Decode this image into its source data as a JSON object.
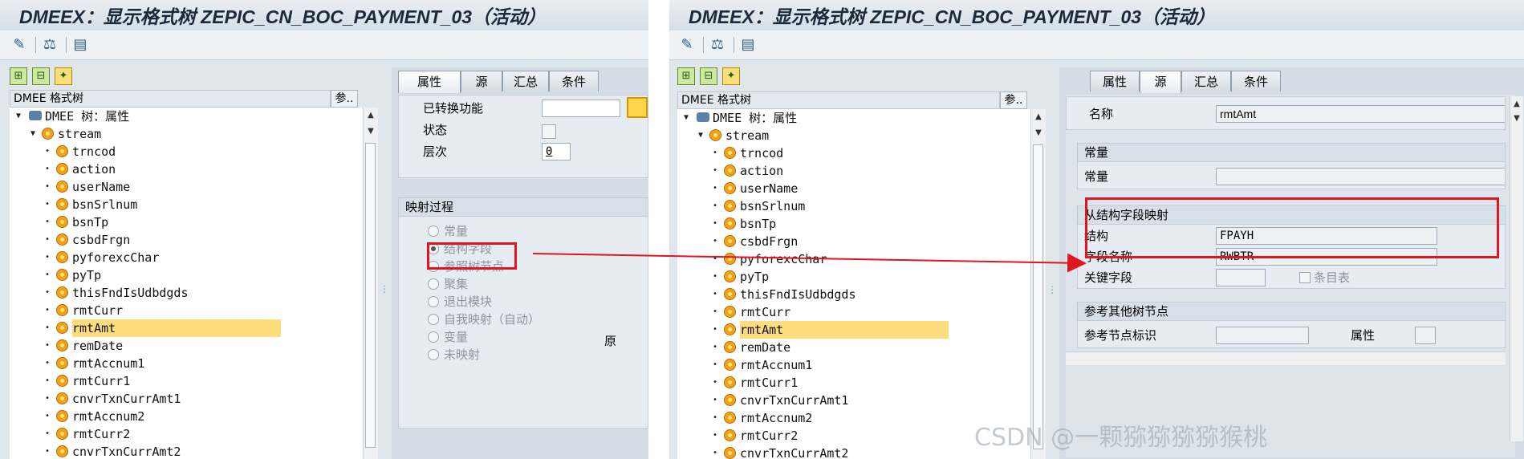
{
  "window_title": "DMEEX：显示格式树 ZEPIC_CN_BOC_PAYMENT_03（活动）",
  "toolbar_icons": [
    "display-change-icon",
    "other-object-icon",
    "hierarchy-icon"
  ],
  "tree": {
    "header_label": "DMEE 格式树",
    "header_button": "参..",
    "root_label": "DMEE 树：属性",
    "stream_label": "stream",
    "nodes": [
      "trncod",
      "action",
      "userName",
      "bsnSrlnum",
      "bsnTp",
      "csbdFrgn",
      "pyforexcChar",
      "pyTp",
      "thisFndIsUdbdgds",
      "rmtCurr",
      "rmtAmt",
      "remDate",
      "rmtAccnum1",
      "rmtCurr1",
      "cnvrTxnCurrAmt1",
      "rmtAccnum2",
      "rmtCurr2",
      "cnvrTxnCurrAmt2"
    ],
    "selected": "rmtAmt"
  },
  "left_panel": {
    "tabs": [
      "属性",
      "源",
      "汇总",
      "条件"
    ],
    "active_tab": "属性",
    "fields": {
      "conversion_label": "已转换功能",
      "status_label": "状态",
      "level_label": "层次",
      "level_value": "0"
    },
    "mapping": {
      "title": "映射过程",
      "options": [
        "常量",
        "结构字段",
        "参照树节点",
        "聚集",
        "退出模块",
        "自我映射（自动）",
        "变量",
        "未映射"
      ],
      "selected": "结构字段",
      "trailing_text": "原"
    }
  },
  "right_panel": {
    "tabs": [
      "属性",
      "源",
      "汇总",
      "条件"
    ],
    "active_tab": "源",
    "name_label": "名称",
    "name_value": "rmtAmt",
    "constant_group": "常量",
    "constant_label": "常量",
    "constant_value": "",
    "struct_group": "从结构字段映射",
    "struct_label": "结构",
    "struct_value": "FPAYH",
    "field_label": "字段名称",
    "field_value": "RWBTR",
    "key_label": "关键字段",
    "entry_table_label": "条目表",
    "ref_group": "参考其他树节点",
    "ref_label": "参考节点标识",
    "attr_label": "属性"
  },
  "watermark": "CSDN @一颗猕猕猕猕猴桃",
  "colors": {
    "highlight": "#ffdc7e",
    "red_box": "#e0151d",
    "node_icon": "#f2a21a"
  }
}
